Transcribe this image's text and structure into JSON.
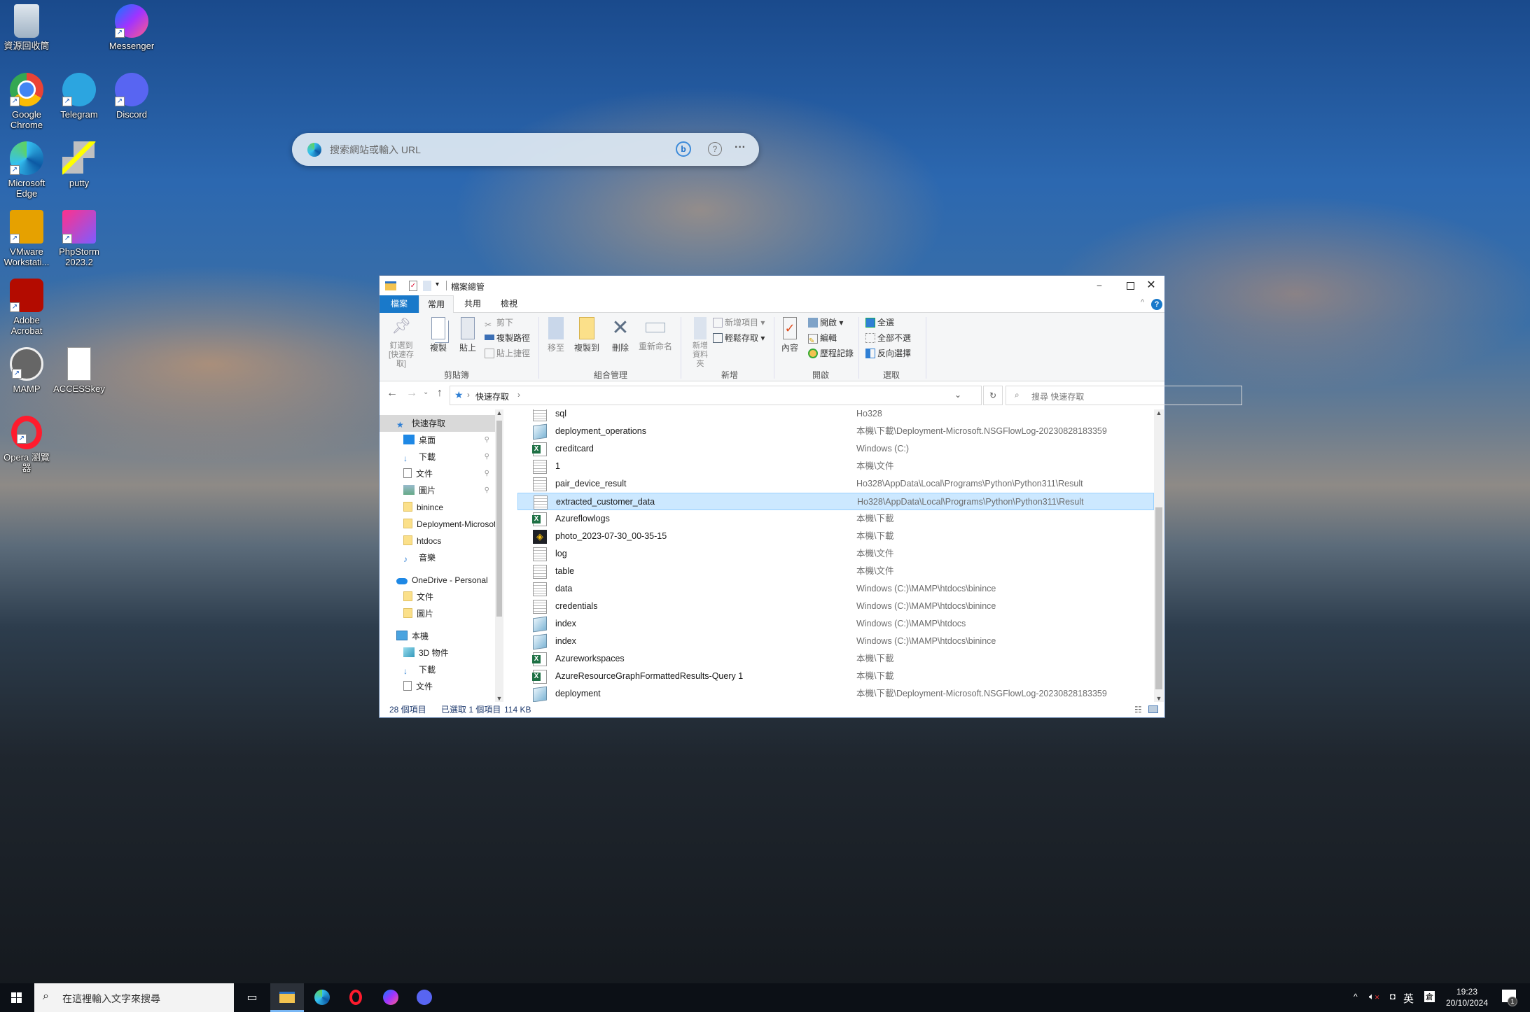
{
  "desktop": {
    "icons": [
      {
        "label": "資源回收筒",
        "icon": "recycle-bin-icon"
      },
      {
        "label": "Messenger",
        "icon": "messenger-icon"
      },
      {
        "label": "Google Chrome",
        "icon": "chrome-icon"
      },
      {
        "label": "Telegram",
        "icon": "telegram-icon"
      },
      {
        "label": "Discord",
        "icon": "discord-icon"
      },
      {
        "label": "Microsoft Edge",
        "icon": "edge-icon"
      },
      {
        "label": "putty",
        "icon": "putty-icon"
      },
      {
        "label": "VMware Workstati...",
        "icon": "vmware-icon"
      },
      {
        "label": "PhpStorm 2023.2",
        "icon": "phpstorm-icon"
      },
      {
        "label": "Adobe Acrobat",
        "icon": "acrobat-icon"
      },
      {
        "label": "MAMP",
        "icon": "mamp-icon"
      },
      {
        "label": "ACCESSkey",
        "icon": "text-file-icon"
      },
      {
        "label": "Opera 瀏覽器",
        "icon": "opera-icon"
      }
    ]
  },
  "edge_search": {
    "placeholder": "搜索網站或輸入 URL"
  },
  "explorer": {
    "title": "檔案總管",
    "tabs": [
      "檔案",
      "常用",
      "共用",
      "檢視"
    ],
    "active_tab": "常用",
    "ribbon": {
      "clipboard": {
        "pin": "釘選到 [快速存取]",
        "copy": "複製",
        "paste": "貼上",
        "cut": "剪下",
        "copy_path": "複製路徑",
        "paste_shortcut": "貼上捷徑",
        "label": "剪貼簿"
      },
      "organize": {
        "move_to": "移至",
        "copy_to": "複製到",
        "delete": "刪除",
        "rename": "重新命名",
        "label": "組合管理"
      },
      "new": {
        "new_folder": "新增資料夾",
        "new_item": "新增項目",
        "easy_access": "輕鬆存取",
        "label": "新增"
      },
      "open": {
        "properties": "內容",
        "open": "開啟",
        "edit": "編輯",
        "history": "歷程記錄",
        "label": "開啟"
      },
      "select": {
        "select_all": "全選",
        "select_none": "全部不選",
        "invert": "反向選擇",
        "label": "選取"
      }
    },
    "address": {
      "crumb": "快速存取"
    },
    "search": {
      "placeholder": "搜尋 快速存取"
    },
    "nav": [
      {
        "label": "快速存取",
        "icon": "star-icon",
        "level": 0,
        "selected": true
      },
      {
        "label": "桌面",
        "icon": "desktop-icon",
        "level": 1,
        "pinned": true
      },
      {
        "label": "下載",
        "icon": "download-icon",
        "level": 1,
        "pinned": true
      },
      {
        "label": "文件",
        "icon": "document-icon",
        "level": 1,
        "pinned": true
      },
      {
        "label": "圖片",
        "icon": "pictures-icon",
        "level": 1,
        "pinned": true
      },
      {
        "label": "binince",
        "icon": "folder-icon",
        "level": 1
      },
      {
        "label": "Deployment-Microsoft",
        "icon": "folder-icon",
        "level": 1
      },
      {
        "label": "htdocs",
        "icon": "folder-icon",
        "level": 1
      },
      {
        "label": "音樂",
        "icon": "music-icon",
        "level": 1
      },
      {
        "label": "OneDrive - Personal",
        "icon": "onedrive-icon",
        "level": 0
      },
      {
        "label": "文件",
        "icon": "folder-icon",
        "level": 1
      },
      {
        "label": "圖片",
        "icon": "folder-icon",
        "level": 1
      },
      {
        "label": "本機",
        "icon": "pc-icon",
        "level": 0
      },
      {
        "label": "3D 物件",
        "icon": "3d-objects-icon",
        "level": 1
      },
      {
        "label": "下載",
        "icon": "download-icon",
        "level": 1
      },
      {
        "label": "文件",
        "icon": "document-icon",
        "level": 1
      }
    ],
    "files": [
      {
        "name": "sql",
        "path": "Ho328",
        "type": "text"
      },
      {
        "name": "deployment_operations",
        "path": "本機\\下載\\Deployment-Microsoft.NSGFlowLog-20230828183359",
        "type": "generic"
      },
      {
        "name": "creditcard",
        "path": "Windows (C:)",
        "type": "excel"
      },
      {
        "name": "1",
        "path": "本機\\文件",
        "type": "text"
      },
      {
        "name": "pair_device_result",
        "path": "Ho328\\AppData\\Local\\Programs\\Python\\Python311\\Result",
        "type": "text"
      },
      {
        "name": "extracted_customer_data",
        "path": "Ho328\\AppData\\Local\\Programs\\Python\\Python311\\Result",
        "type": "text",
        "selected": true
      },
      {
        "name": "Azureflowlogs",
        "path": "本機\\下載",
        "type": "excel"
      },
      {
        "name": "photo_2023-07-30_00-35-15",
        "path": "本機\\下載",
        "type": "image"
      },
      {
        "name": "log",
        "path": "本機\\文件",
        "type": "text"
      },
      {
        "name": "table",
        "path": "本機\\文件",
        "type": "text"
      },
      {
        "name": "data",
        "path": "Windows (C:)\\MAMP\\htdocs\\binince",
        "type": "text"
      },
      {
        "name": "credentials",
        "path": "Windows (C:)\\MAMP\\htdocs\\binince",
        "type": "text"
      },
      {
        "name": "index",
        "path": "Windows (C:)\\MAMP\\htdocs",
        "type": "generic"
      },
      {
        "name": "index",
        "path": "Windows (C:)\\MAMP\\htdocs\\binince",
        "type": "generic"
      },
      {
        "name": "Azureworkspaces",
        "path": "本機\\下載",
        "type": "excel"
      },
      {
        "name": "AzureResourceGraphFormattedResults-Query 1",
        "path": "本機\\下載",
        "type": "excel"
      },
      {
        "name": "deployment",
        "path": "本機\\下載\\Deployment-Microsoft.NSGFlowLog-20230828183359",
        "type": "generic"
      }
    ],
    "status": {
      "count": "28 個項目",
      "selected": "已選取 1 個項目",
      "size": "114 KB"
    }
  },
  "taskbar": {
    "search_placeholder": "在這裡輸入文字來搜尋",
    "ime": "英",
    "time": "19:23",
    "date": "20/10/2024",
    "notifications": "1"
  },
  "colors": {
    "accent": "#1979ca",
    "selection": "#cce8ff",
    "taskbar": "#0c1016"
  }
}
